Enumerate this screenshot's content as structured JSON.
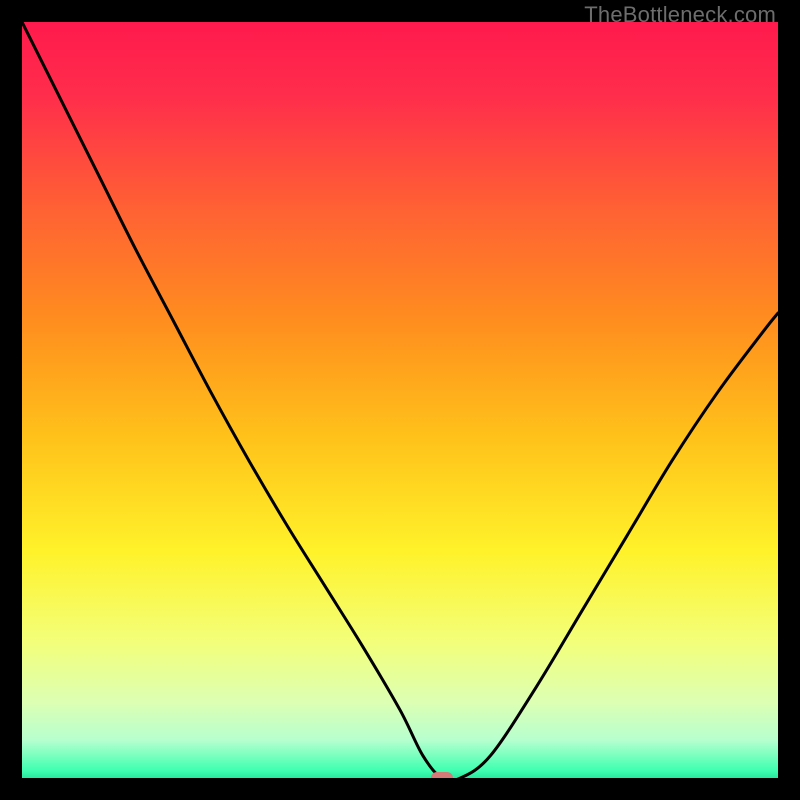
{
  "watermark": "TheBottleneck.com",
  "colors": {
    "frame": "#000000",
    "curve": "#000000",
    "marker": "#d67a78",
    "gradient_stops": [
      {
        "offset": 0.0,
        "color": "#ff1a4d"
      },
      {
        "offset": 0.1,
        "color": "#ff2e4b"
      },
      {
        "offset": 0.25,
        "color": "#ff6233"
      },
      {
        "offset": 0.4,
        "color": "#ff8f1e"
      },
      {
        "offset": 0.55,
        "color": "#ffc21a"
      },
      {
        "offset": 0.7,
        "color": "#fff22a"
      },
      {
        "offset": 0.82,
        "color": "#f3ff7a"
      },
      {
        "offset": 0.9,
        "color": "#dcffb3"
      },
      {
        "offset": 0.95,
        "color": "#b6ffcf"
      },
      {
        "offset": 0.99,
        "color": "#3fffb0"
      },
      {
        "offset": 1.0,
        "color": "#28e89f"
      }
    ]
  },
  "chart_data": {
    "type": "line",
    "title": "",
    "xlabel": "",
    "ylabel": "",
    "xlim": [
      0,
      1
    ],
    "ylim": [
      0,
      1
    ],
    "grid": false,
    "legend": false,
    "marker": {
      "x": 0.555,
      "y": 0.0
    },
    "series": [
      {
        "name": "curve",
        "x": [
          0.0,
          0.05,
          0.1,
          0.15,
          0.2,
          0.25,
          0.3,
          0.35,
          0.4,
          0.45,
          0.5,
          0.53,
          0.555,
          0.58,
          0.62,
          0.68,
          0.74,
          0.8,
          0.86,
          0.92,
          0.98,
          1.0
        ],
        "values": [
          1.0,
          0.9,
          0.8,
          0.7,
          0.605,
          0.51,
          0.42,
          0.335,
          0.255,
          0.175,
          0.09,
          0.03,
          0.0,
          0.0,
          0.03,
          0.12,
          0.22,
          0.32,
          0.42,
          0.51,
          0.59,
          0.615
        ]
      }
    ]
  }
}
